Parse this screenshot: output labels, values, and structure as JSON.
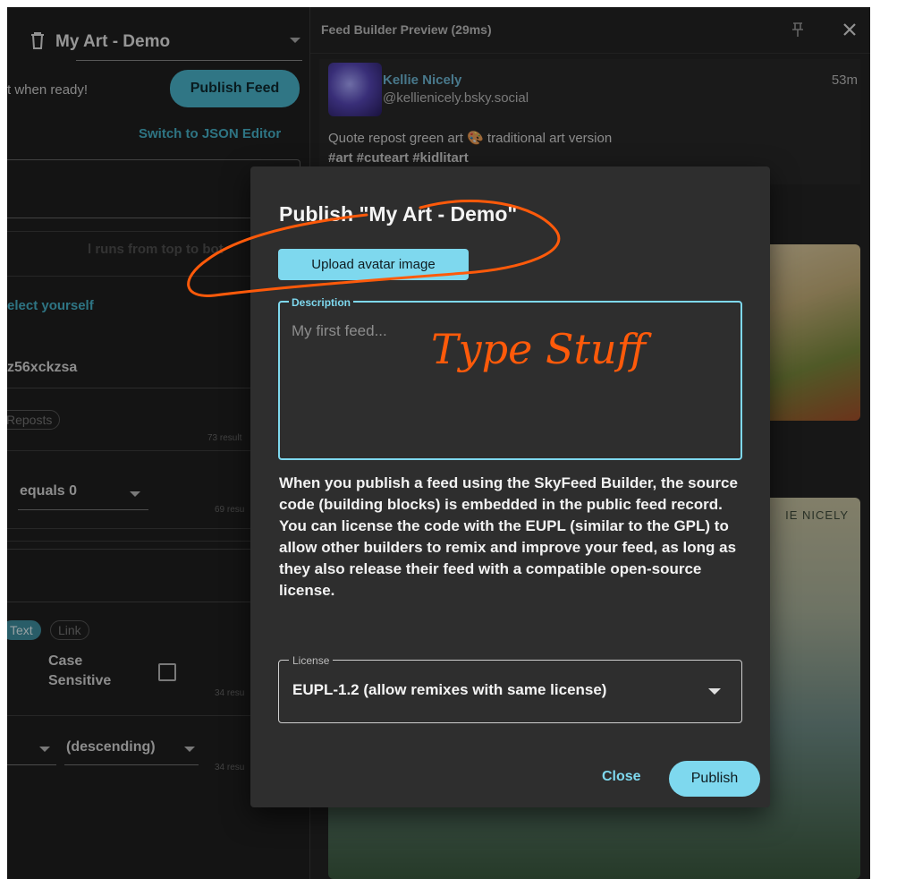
{
  "left_panel": {
    "feed_name": "My Art - Demo",
    "ready_text": "t when ready!",
    "publish_feed_label": "Publish Feed",
    "switch_json_label": "Switch to JSON Editor",
    "runs_text": "l runs from top to bot",
    "select_yourself": "elect yourself",
    "did_fragment": "z56xckzsa",
    "reposts_chip": "Reposts",
    "result_73": "73 result",
    "equals_label": "equals 0",
    "result_69": "69 resu",
    "text_chip": "Text",
    "link_chip": "Link",
    "case_label_1": "Case",
    "case_label_2": "Sensitive",
    "result_34a": "34 resu",
    "sort_label": "(descending)",
    "result_34b": "34 resu"
  },
  "preview": {
    "title": "Feed Builder Preview (29ms)",
    "post": {
      "author": "Kellie Nicely",
      "handle": "@kellienicely.bsky.social",
      "time": "53m",
      "text": "Quote repost green art 🎨 traditional art version",
      "tags": "#art #cuteart #kidlitart"
    },
    "art_signature": "IE NICELY"
  },
  "dialog": {
    "title": "Publish \"My Art - Demo\"",
    "upload_label": "Upload avatar image",
    "description_label": "Description",
    "description_placeholder": "My first feed...",
    "info_line_1": "When you publish a feed using the SkyFeed Builder, the source code (building blocks) is embedded in the public feed record.",
    "info_line_2": "You can license the code with the EUPL (similar to the GPL) to allow other builders to remix and improve your feed, as long as they also release their feed with a compatible open-source license.",
    "license_label": "License",
    "license_value": "EUPL-1.2 (allow remixes with same license)",
    "close_label": "Close",
    "publish_label": "Publish"
  },
  "annotation": {
    "handwritten": "Type Stuff",
    "color": "#ff5a0a"
  },
  "colors": {
    "accent": "#7ed8ee",
    "dialog_bg": "#2e2e2e",
    "app_bg": "#1c1c1c"
  }
}
